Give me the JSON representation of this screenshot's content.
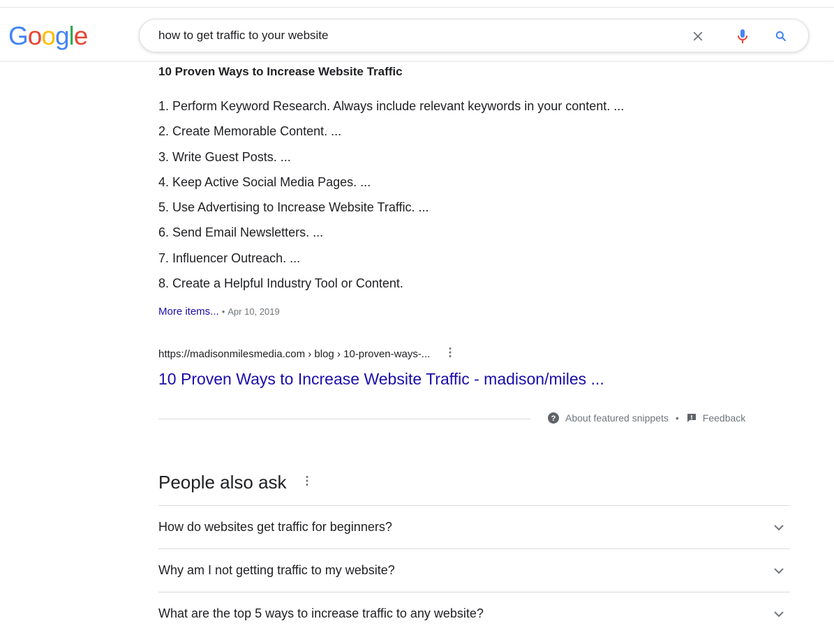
{
  "header": {
    "logo_text": "Google",
    "logo_letters": [
      {
        "ch": "G",
        "color": "#4285f4"
      },
      {
        "ch": "o",
        "color": "#ea4335"
      },
      {
        "ch": "o",
        "color": "#fbbc05"
      },
      {
        "ch": "g",
        "color": "#4285f4"
      },
      {
        "ch": "l",
        "color": "#34a853"
      },
      {
        "ch": "e",
        "color": "#ea4335"
      }
    ],
    "search": {
      "value": "how to get traffic to your website"
    }
  },
  "snippet": {
    "title": "10 Proven Ways to Increase Website Traffic",
    "items": [
      "1. Perform Keyword Research. Always include relevant keywords in your content. ...",
      "2. Create Memorable Content. ...",
      "3. Write Guest Posts. ...",
      "4. Keep Active Social Media Pages. ...",
      "5. Use Advertising to Increase Website Traffic. ...",
      "6. Send Email Newsletters. ...",
      "7. Influencer Outreach. ...",
      "8. Create a Helpful Industry Tool or Content."
    ],
    "more_link": "More items...",
    "dot": "•",
    "date": "Apr 10, 2019",
    "url": "https://madisonmilesmedia.com › blog › 10-proven-ways-...",
    "result_title": "10 Proven Ways to Increase Website Traffic - madison/miles ...",
    "about_label": "About featured snippets",
    "footer_dot": "•",
    "feedback_label": "Feedback"
  },
  "people_also_ask": {
    "title": "People also ask",
    "questions": [
      "How do websites get traffic for beginners?",
      "Why am I not getting traffic to my website?",
      "What are the top 5 ways to increase traffic to any website?"
    ]
  },
  "icons": {
    "clear": "close-icon",
    "mic": "microphone-icon",
    "search": "search-icon",
    "more": "more-vert-icon",
    "help": "help-icon",
    "feedback": "feedback-icon",
    "chevron": "chevron-down-icon"
  },
  "colors": {
    "link": "#1a0dab",
    "muted": "#70757a",
    "text": "#202124",
    "mic_blue": "#4285f4",
    "mic_red": "#ea4335"
  }
}
